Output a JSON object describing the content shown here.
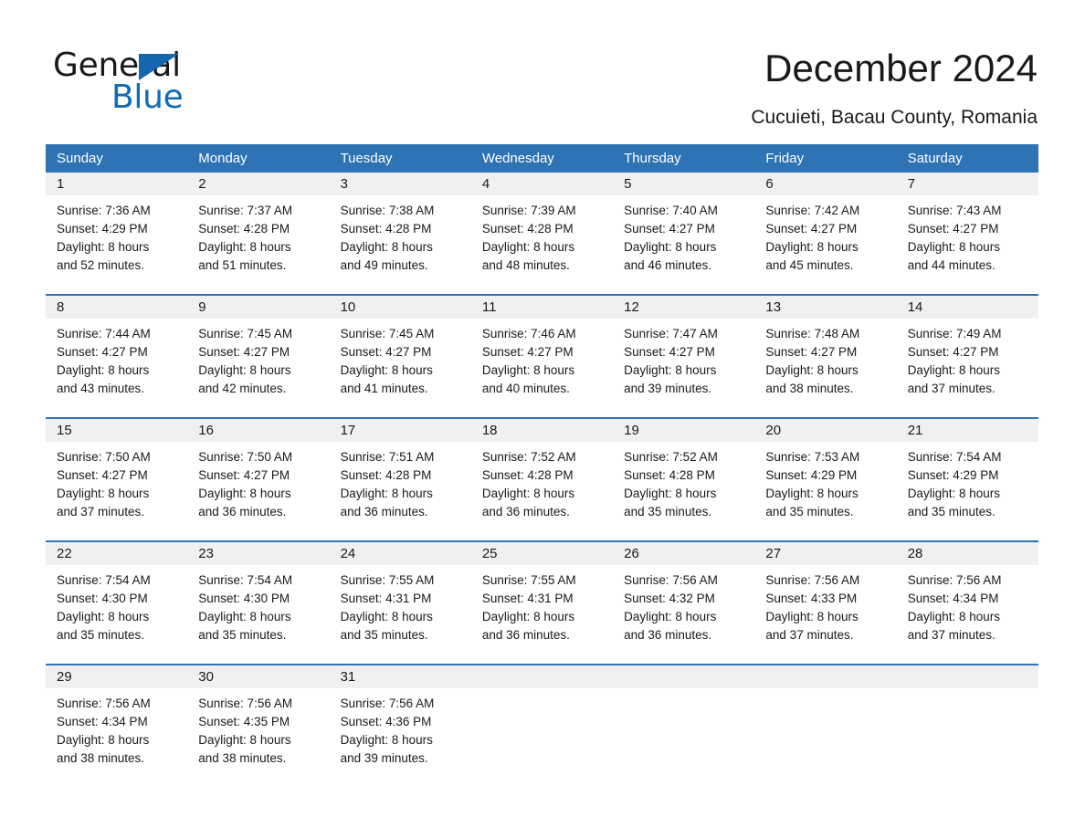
{
  "brand": {
    "name_part1": "General",
    "name_part2": "Blue",
    "accent_color": "#0f6cb5"
  },
  "header": {
    "title": "December 2024",
    "subtitle": "Cucuieti, Bacau County, Romania"
  },
  "theme": {
    "header_blue": "#2e74b5",
    "day_band_gray": "#f0f0f0",
    "text_color": "#1a1a1a"
  },
  "weekdays": [
    "Sunday",
    "Monday",
    "Tuesday",
    "Wednesday",
    "Thursday",
    "Friday",
    "Saturday"
  ],
  "weeks": [
    [
      {
        "day": "1",
        "sunrise": "Sunrise: 7:36 AM",
        "sunset": "Sunset: 4:29 PM",
        "daylight_line1": "Daylight: 8 hours",
        "daylight_line2": "and 52 minutes."
      },
      {
        "day": "2",
        "sunrise": "Sunrise: 7:37 AM",
        "sunset": "Sunset: 4:28 PM",
        "daylight_line1": "Daylight: 8 hours",
        "daylight_line2": "and 51 minutes."
      },
      {
        "day": "3",
        "sunrise": "Sunrise: 7:38 AM",
        "sunset": "Sunset: 4:28 PM",
        "daylight_line1": "Daylight: 8 hours",
        "daylight_line2": "and 49 minutes."
      },
      {
        "day": "4",
        "sunrise": "Sunrise: 7:39 AM",
        "sunset": "Sunset: 4:28 PM",
        "daylight_line1": "Daylight: 8 hours",
        "daylight_line2": "and 48 minutes."
      },
      {
        "day": "5",
        "sunrise": "Sunrise: 7:40 AM",
        "sunset": "Sunset: 4:27 PM",
        "daylight_line1": "Daylight: 8 hours",
        "daylight_line2": "and 46 minutes."
      },
      {
        "day": "6",
        "sunrise": "Sunrise: 7:42 AM",
        "sunset": "Sunset: 4:27 PM",
        "daylight_line1": "Daylight: 8 hours",
        "daylight_line2": "and 45 minutes."
      },
      {
        "day": "7",
        "sunrise": "Sunrise: 7:43 AM",
        "sunset": "Sunset: 4:27 PM",
        "daylight_line1": "Daylight: 8 hours",
        "daylight_line2": "and 44 minutes."
      }
    ],
    [
      {
        "day": "8",
        "sunrise": "Sunrise: 7:44 AM",
        "sunset": "Sunset: 4:27 PM",
        "daylight_line1": "Daylight: 8 hours",
        "daylight_line2": "and 43 minutes."
      },
      {
        "day": "9",
        "sunrise": "Sunrise: 7:45 AM",
        "sunset": "Sunset: 4:27 PM",
        "daylight_line1": "Daylight: 8 hours",
        "daylight_line2": "and 42 minutes."
      },
      {
        "day": "10",
        "sunrise": "Sunrise: 7:45 AM",
        "sunset": "Sunset: 4:27 PM",
        "daylight_line1": "Daylight: 8 hours",
        "daylight_line2": "and 41 minutes."
      },
      {
        "day": "11",
        "sunrise": "Sunrise: 7:46 AM",
        "sunset": "Sunset: 4:27 PM",
        "daylight_line1": "Daylight: 8 hours",
        "daylight_line2": "and 40 minutes."
      },
      {
        "day": "12",
        "sunrise": "Sunrise: 7:47 AM",
        "sunset": "Sunset: 4:27 PM",
        "daylight_line1": "Daylight: 8 hours",
        "daylight_line2": "and 39 minutes."
      },
      {
        "day": "13",
        "sunrise": "Sunrise: 7:48 AM",
        "sunset": "Sunset: 4:27 PM",
        "daylight_line1": "Daylight: 8 hours",
        "daylight_line2": "and 38 minutes."
      },
      {
        "day": "14",
        "sunrise": "Sunrise: 7:49 AM",
        "sunset": "Sunset: 4:27 PM",
        "daylight_line1": "Daylight: 8 hours",
        "daylight_line2": "and 37 minutes."
      }
    ],
    [
      {
        "day": "15",
        "sunrise": "Sunrise: 7:50 AM",
        "sunset": "Sunset: 4:27 PM",
        "daylight_line1": "Daylight: 8 hours",
        "daylight_line2": "and 37 minutes."
      },
      {
        "day": "16",
        "sunrise": "Sunrise: 7:50 AM",
        "sunset": "Sunset: 4:27 PM",
        "daylight_line1": "Daylight: 8 hours",
        "daylight_line2": "and 36 minutes."
      },
      {
        "day": "17",
        "sunrise": "Sunrise: 7:51 AM",
        "sunset": "Sunset: 4:28 PM",
        "daylight_line1": "Daylight: 8 hours",
        "daylight_line2": "and 36 minutes."
      },
      {
        "day": "18",
        "sunrise": "Sunrise: 7:52 AM",
        "sunset": "Sunset: 4:28 PM",
        "daylight_line1": "Daylight: 8 hours",
        "daylight_line2": "and 36 minutes."
      },
      {
        "day": "19",
        "sunrise": "Sunrise: 7:52 AM",
        "sunset": "Sunset: 4:28 PM",
        "daylight_line1": "Daylight: 8 hours",
        "daylight_line2": "and 35 minutes."
      },
      {
        "day": "20",
        "sunrise": "Sunrise: 7:53 AM",
        "sunset": "Sunset: 4:29 PM",
        "daylight_line1": "Daylight: 8 hours",
        "daylight_line2": "and 35 minutes."
      },
      {
        "day": "21",
        "sunrise": "Sunrise: 7:54 AM",
        "sunset": "Sunset: 4:29 PM",
        "daylight_line1": "Daylight: 8 hours",
        "daylight_line2": "and 35 minutes."
      }
    ],
    [
      {
        "day": "22",
        "sunrise": "Sunrise: 7:54 AM",
        "sunset": "Sunset: 4:30 PM",
        "daylight_line1": "Daylight: 8 hours",
        "daylight_line2": "and 35 minutes."
      },
      {
        "day": "23",
        "sunrise": "Sunrise: 7:54 AM",
        "sunset": "Sunset: 4:30 PM",
        "daylight_line1": "Daylight: 8 hours",
        "daylight_line2": "and 35 minutes."
      },
      {
        "day": "24",
        "sunrise": "Sunrise: 7:55 AM",
        "sunset": "Sunset: 4:31 PM",
        "daylight_line1": "Daylight: 8 hours",
        "daylight_line2": "and 35 minutes."
      },
      {
        "day": "25",
        "sunrise": "Sunrise: 7:55 AM",
        "sunset": "Sunset: 4:31 PM",
        "daylight_line1": "Daylight: 8 hours",
        "daylight_line2": "and 36 minutes."
      },
      {
        "day": "26",
        "sunrise": "Sunrise: 7:56 AM",
        "sunset": "Sunset: 4:32 PM",
        "daylight_line1": "Daylight: 8 hours",
        "daylight_line2": "and 36 minutes."
      },
      {
        "day": "27",
        "sunrise": "Sunrise: 7:56 AM",
        "sunset": "Sunset: 4:33 PM",
        "daylight_line1": "Daylight: 8 hours",
        "daylight_line2": "and 37 minutes."
      },
      {
        "day": "28",
        "sunrise": "Sunrise: 7:56 AM",
        "sunset": "Sunset: 4:34 PM",
        "daylight_line1": "Daylight: 8 hours",
        "daylight_line2": "and 37 minutes."
      }
    ],
    [
      {
        "day": "29",
        "sunrise": "Sunrise: 7:56 AM",
        "sunset": "Sunset: 4:34 PM",
        "daylight_line1": "Daylight: 8 hours",
        "daylight_line2": "and 38 minutes."
      },
      {
        "day": "30",
        "sunrise": "Sunrise: 7:56 AM",
        "sunset": "Sunset: 4:35 PM",
        "daylight_line1": "Daylight: 8 hours",
        "daylight_line2": "and 38 minutes."
      },
      {
        "day": "31",
        "sunrise": "Sunrise: 7:56 AM",
        "sunset": "Sunset: 4:36 PM",
        "daylight_line1": "Daylight: 8 hours",
        "daylight_line2": "and 39 minutes."
      },
      {
        "day": "",
        "sunrise": "",
        "sunset": "",
        "daylight_line1": "",
        "daylight_line2": ""
      },
      {
        "day": "",
        "sunrise": "",
        "sunset": "",
        "daylight_line1": "",
        "daylight_line2": ""
      },
      {
        "day": "",
        "sunrise": "",
        "sunset": "",
        "daylight_line1": "",
        "daylight_line2": ""
      },
      {
        "day": "",
        "sunrise": "",
        "sunset": "",
        "daylight_line1": "",
        "daylight_line2": ""
      }
    ]
  ]
}
